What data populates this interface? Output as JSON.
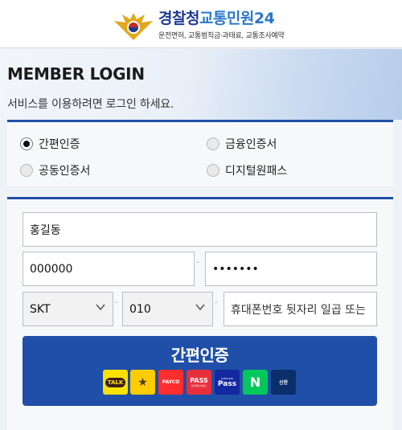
{
  "header": {
    "brand_part1": "경찰청",
    "brand_part2": "교통민원24",
    "subtitle": "운전면허, 교통범칙금·과태료, 교통조사예약",
    "emblem_icon": "police-emblem-icon"
  },
  "login": {
    "title": "MEMBER LOGIN",
    "description": "서비스를 이용하려면 로그인 하세요."
  },
  "auth_methods": [
    {
      "label": "간편인증",
      "selected": true
    },
    {
      "label": "금융인증서",
      "selected": false
    },
    {
      "label": "공동인증서",
      "selected": false
    },
    {
      "label": "디지털원패스",
      "selected": false
    }
  ],
  "form": {
    "name_value": "홍길동",
    "birth_value": "000000",
    "password_value": "•••••••",
    "dash": "-",
    "carrier_value": "SKT",
    "phone_prefix_value": "010",
    "phone_placeholder": "휴대폰번호 뒷자리 일곱 또는"
  },
  "easy_auth": {
    "label": "간편인증",
    "providers": [
      {
        "name": "kakao",
        "text": "TALK",
        "color": "#fae100",
        "text_color": "#3c1e1e"
      },
      {
        "name": "kb",
        "text": "★",
        "color": "#ffcc00",
        "text_color": "#4a3b1c"
      },
      {
        "name": "payco",
        "text": "PAYCO",
        "color": "#ff2e2e",
        "text_color": "#ffffff"
      },
      {
        "name": "pass",
        "text": "PASS",
        "color": "#e8303d",
        "text_color": "#ffffff"
      },
      {
        "name": "samsung-pass",
        "text": "Pass",
        "color": "#1428a0",
        "text_color": "#ffffff"
      },
      {
        "name": "naver",
        "text": "N",
        "color": "#03c75a",
        "text_color": "#ffffff"
      },
      {
        "name": "shinhan",
        "text": "신한",
        "color": "#0a2f6b",
        "text_color": "#ffffff"
      }
    ],
    "samsung_top": "SAMSUNG",
    "pass_sub": "본인확인서비스"
  }
}
